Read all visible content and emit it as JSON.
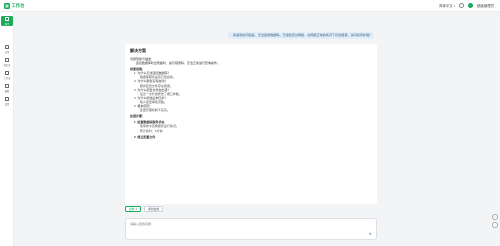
{
  "app": {
    "logo_mark": "▦",
    "logo_text": "工作台"
  },
  "header": {
    "language": "简体中文",
    "user": "超级管理员"
  },
  "sidebar": {
    "items": [
      {
        "label": "助手"
      },
      {
        "label": "应用"
      },
      {
        "label": "知识库"
      },
      {
        "label": "工作流"
      },
      {
        "label": "数据"
      },
      {
        "label": "设置"
      }
    ]
  },
  "chat": {
    "question": "我遇到的问题是：无法连接数据库。已经检查过网络，在网络正常的情况下仍然报错，请问如何处理？",
    "answer_title": "解决方案",
    "lines": [
      {
        "text": "问题现象与描述：",
        "level": 0,
        "bold": false
      },
      {
        "text": "· 连接数据库时出现超时，提示错误码，无法正常进行查询操作。",
        "level": 1,
        "bold": false
      },
      {
        "text": "排查思路：",
        "level": 0,
        "bold": true
      },
      {
        "text": "1. 为什么无法连接数据库？",
        "level": 1,
        "bold": false
      },
      {
        "text": "· 数据库服务是否已经启动。",
        "level": 2,
        "bold": false
      },
      {
        "text": "2. 为什么服务没有启动？",
        "level": 1,
        "bold": false
      },
      {
        "text": "· 服务配置文件存在错误。",
        "level": 2,
        "bold": false
      },
      {
        "text": "3. 为什么配置文件会出错？",
        "level": 1,
        "bold": false
      },
      {
        "text": "· 最近一次升级修改了端口参数。",
        "level": 2,
        "bold": false
      },
      {
        "text": "4. 为什么修改后未同步？",
        "level": 1,
        "bold": false
      },
      {
        "text": "· 缺少变更审批流程。",
        "level": 2,
        "bold": false
      },
      {
        "text": "5. 根本原因：",
        "level": 1,
        "bold": false
      },
      {
        "text": "· 变更管理机制不完善。",
        "level": 2,
        "bold": false
      },
      {
        "text": "处理步骤：",
        "level": 0,
        "bold": true
      },
      {
        "text": "1. 检查数据库服务状态",
        "level": 1,
        "bold": true
      },
      {
        "text": "· 使用命令查看服务运行情况。",
        "level": 2,
        "bold": false
      },
      {
        "text": "· 预计耗时：5分钟",
        "level": 2,
        "bold": false
      },
      {
        "text": "2. 修正配置文件",
        "level": 1,
        "bold": true
      }
    ]
  },
  "actions": {
    "copy": "复制",
    "regenerate": "重新生成"
  },
  "input": {
    "placeholder": "请输入您的问题..."
  },
  "icons": {
    "send": "send-icon",
    "float_top": "arrow-up-icon",
    "float_bottom": "arrow-down-icon"
  },
  "colors": {
    "accent": "#1bab5b",
    "question_bg": "#e2eef9",
    "page_bg": "#f3f4f6"
  }
}
